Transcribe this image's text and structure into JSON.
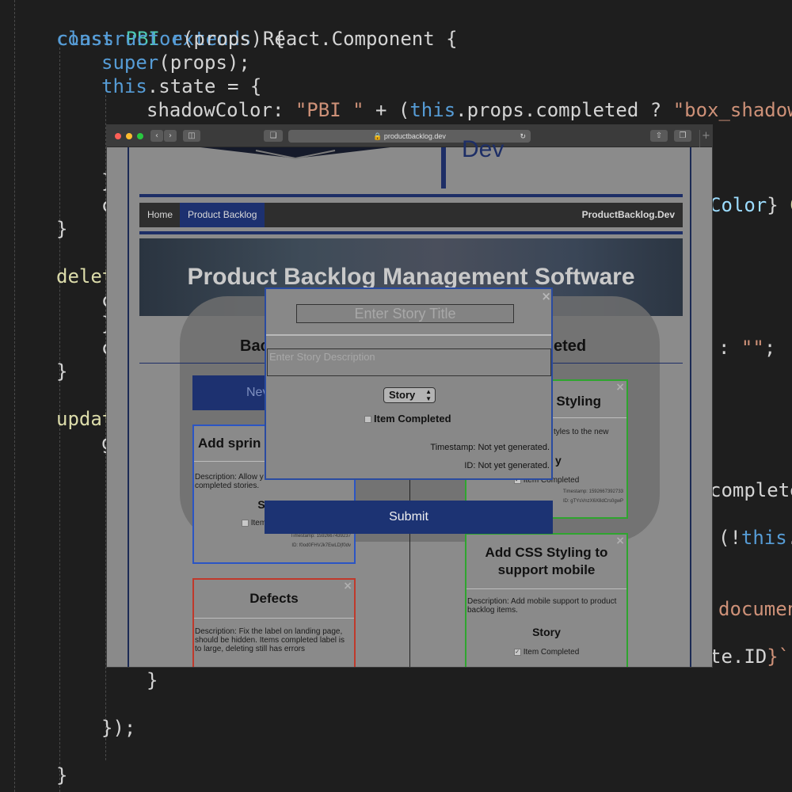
{
  "editor": {
    "line_class": {
      "kw_class": "class",
      "name": "PBI",
      "kw_extends": "extends",
      "base": "React.Component {"
    },
    "line_constructor": {
      "fn": "constructor",
      "rest": "(props) {"
    },
    "line_super": {
      "fn": "super",
      "rest": "(props);"
    },
    "line_state": {
      "kw": "this",
      "rest": ".state = {"
    },
    "line_shadow": {
      "prop": "shadowColor: ",
      "str1": "\"PBI \"",
      "op": " + (",
      "kw": "this",
      "rest": ".props.completed ? ",
      "str2": "\"box_shadow"
    },
    "line_brace1": "}",
    "line_c1": "c",
    "line_c1_right": {
      "prop": "Color",
      "rest": "} ",
      "tail": "C"
    },
    "line_close_ctor": "}",
    "line_delete": "delet",
    "line_c2": "c",
    "line_brace2": "}",
    "line_c3": "c",
    "line_c3_right": {
      "op": ": ",
      "str": "\"\"",
      "tail": ";"
    },
    "line_close_delete": "}",
    "line_update": "updat",
    "line_g": "g",
    "line_complete_right": "complete",
    "line_not_this": {
      "op": "(!",
      "kw": "this",
      "tail": "."
    },
    "line_document": "documen",
    "line_te_id": {
      "rest": "te.ID",
      "tail": "}`)"
    },
    "line_close_inner": "}",
    "line_close_paren": "});",
    "line_close_update": "}"
  },
  "browser": {
    "url": "productbacklog.dev",
    "new_tab": "+"
  },
  "site": {
    "logo_text": "Dev",
    "nav": {
      "home": "Home",
      "product_backlog": "Product Backlog",
      "brand": "ProductBacklog.Dev"
    },
    "hero_title": "Product Backlog Management Software",
    "col_backlog": "Bac",
    "col_completed": "eted",
    "new_button": "Nev"
  },
  "cards": {
    "left": [
      {
        "title": "Add sprin",
        "description": "Description: Allow y completed stories.",
        "type": "S",
        "completed_label": "Item Completed",
        "timestamp": "Timestamp: 1592667439237",
        "id": "ID: f0od0FHVJk7EwLD|f0dv"
      },
      {
        "title": "Defects",
        "description": "Description: Fix the label on landing page, should be hidden. Items completed label is to large, deleting still has errors"
      }
    ],
    "right": [
      {
        "title": "Styling",
        "description": "tyles to the new",
        "type": "y",
        "completed_label": "Item Completed",
        "timestamp": "Timestamp: 1592667392733",
        "id": "ID: gTYsVnzX6X8dCrs0gwP"
      },
      {
        "title": "Add CSS Styling to support mobile",
        "description": "Description: Add mobile support to product backlog items.",
        "type": "Story",
        "completed_label": "Item Completed"
      }
    ],
    "close_glyph": "×"
  },
  "modal": {
    "title_placeholder": "Enter Story Title",
    "description_placeholder": "Enter Story Description",
    "type_selected": "Story",
    "completed_label": "Item Completed",
    "timestamp": "Timestamp: Not yet generated.",
    "id": "ID: Not yet generated.",
    "close_glyph": "×",
    "submit_label": "Submit"
  },
  "colors": {
    "accent_blue": "#1d3170",
    "left_card_border": "#2b55c4",
    "defect_card_border": "#c0392b",
    "completed_card_border": "#2fa52f"
  }
}
